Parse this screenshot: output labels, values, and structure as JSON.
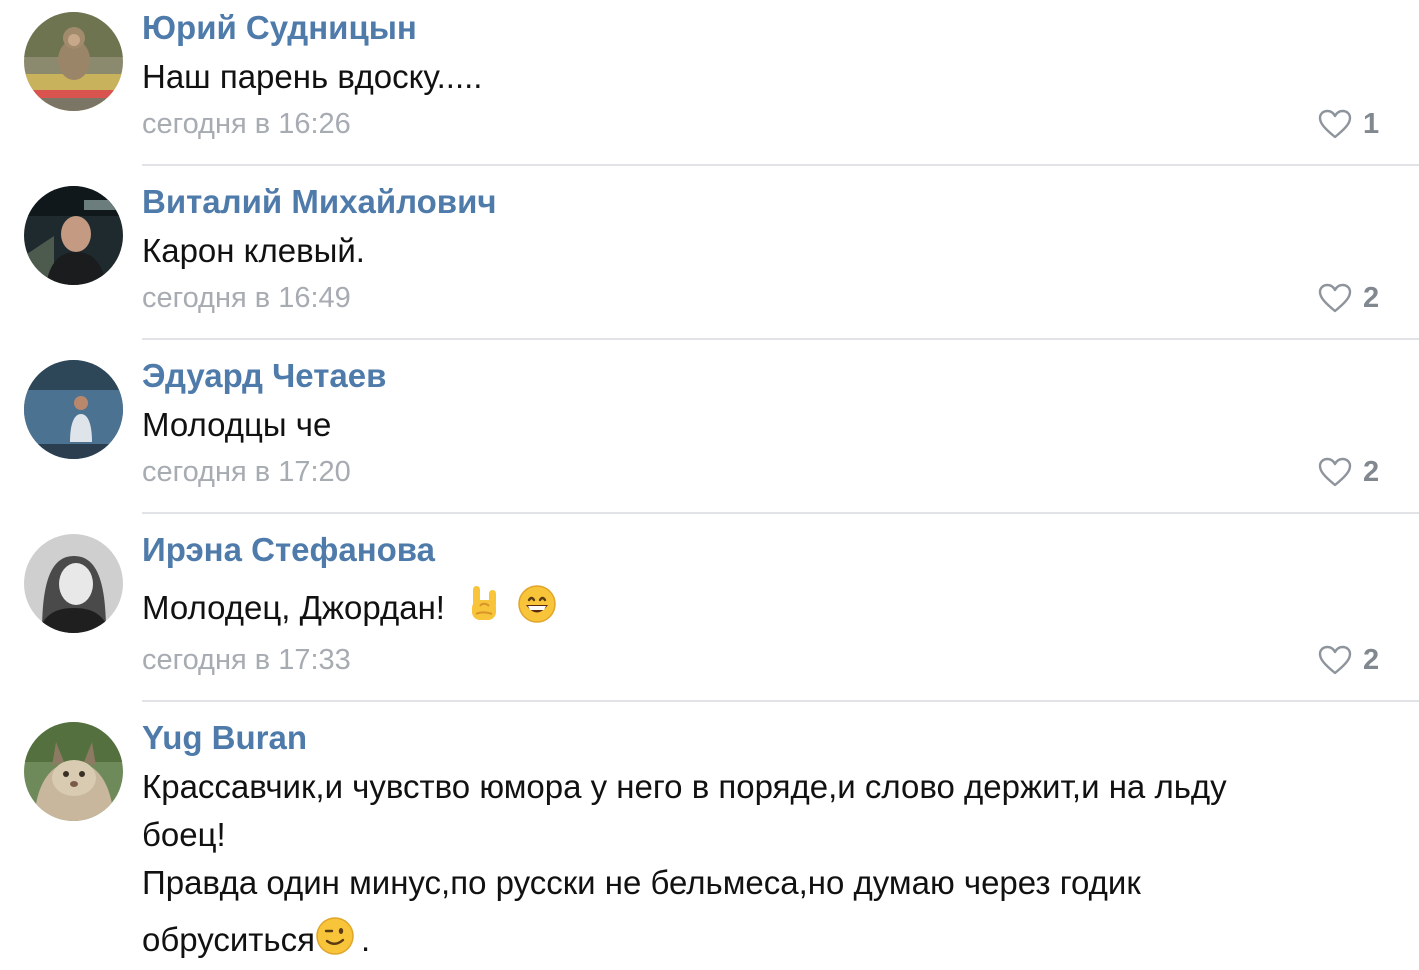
{
  "accent_color": "#4f7bab",
  "time_color": "#a7abb2",
  "comments": [
    {
      "author": "Юрий Судницын",
      "text": "Наш парень вдоску.....",
      "time": "сегодня в 16:26",
      "likes": "1",
      "avatar_icon": "monkey-avatar"
    },
    {
      "author": "Виталий Михайлович",
      "text": "Карон клевый.",
      "time": "сегодня в 16:49",
      "likes": "2",
      "avatar_icon": "man-night-avatar"
    },
    {
      "author": "Эдуард Четаев",
      "text": "Молодцы че",
      "time": "сегодня в 17:20",
      "likes": "2",
      "avatar_icon": "man-lake-avatar"
    },
    {
      "author": "Ирэна Стефанова",
      "text": "Молодец, Джордан!",
      "text_emoji": [
        "horns-emoji",
        "grinning-face-emoji"
      ],
      "time": "сегодня в 17:33",
      "likes": "2",
      "avatar_icon": "woman-bw-avatar"
    },
    {
      "author": "Yug Buran",
      "text_lines": [
        "Крассавчик,и чувство юмора у него в поряде,и слово держит,и на льду",
        "боец!",
        "Правда один минус,по русски не бельмеса,но думаю через годик",
        "обруситься",
        "."
      ],
      "text_emoji": [
        "winking-face-emoji"
      ],
      "avatar_icon": "lynx-avatar"
    }
  ]
}
